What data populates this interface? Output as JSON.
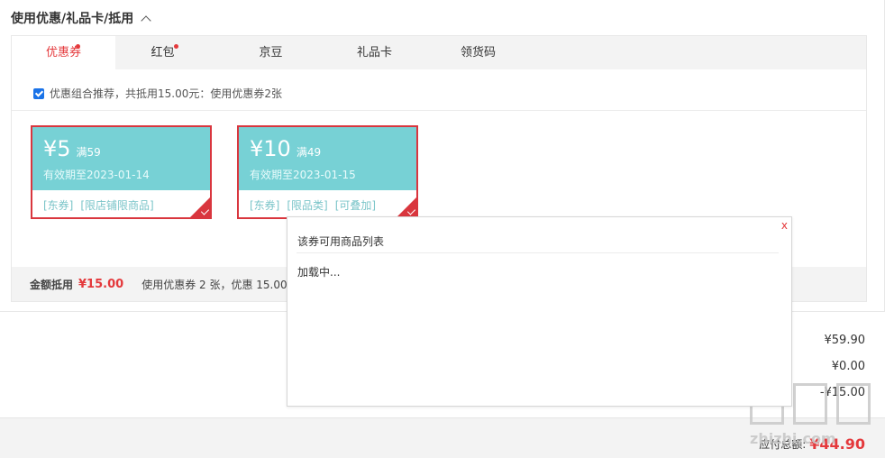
{
  "section": {
    "title": "使用优惠/礼品卡/抵用"
  },
  "tabs": [
    {
      "label": "优惠券",
      "active": true,
      "dot": true
    },
    {
      "label": "红包",
      "active": false,
      "dot": true
    },
    {
      "label": "京豆",
      "active": false,
      "dot": false
    },
    {
      "label": "礼品卡",
      "active": false,
      "dot": false
    },
    {
      "label": "领货码",
      "active": false,
      "dot": false
    }
  ],
  "recommend": {
    "text": "优惠组合推荐，共抵用15.00元：使用优惠券2张",
    "checked": true
  },
  "coupons": [
    {
      "amount": "¥5",
      "condition": "满59",
      "validity": "有效期至2023-01-14",
      "tags": [
        "[东券]",
        "[限店铺限商品]"
      ],
      "selected": true
    },
    {
      "amount": "¥10",
      "condition": "满49",
      "validity": "有效期至2023-01-15",
      "tags": [
        "[东券]",
        "[限品类]",
        "[可叠加]"
      ],
      "selected": true
    }
  ],
  "summary": {
    "label": "金额抵用",
    "amount": "¥15.00",
    "detail": "使用优惠券 2 张，优惠 15.00 元"
  },
  "prices": [
    "¥59.90",
    "¥0.00",
    "-¥15.00"
  ],
  "footer": {
    "label": "应付总额:",
    "amount": "¥44.90"
  },
  "popup": {
    "close": "x",
    "title": "该券可用商品列表",
    "loading": "加载中..."
  },
  "watermark": {
    "site": "zhizhi.com"
  },
  "colors": {
    "accent": "#e4393c",
    "coupon_bg": "#77d1d5",
    "coupon_border": "#d9363e",
    "tab_bg": "#f3f3f3"
  }
}
